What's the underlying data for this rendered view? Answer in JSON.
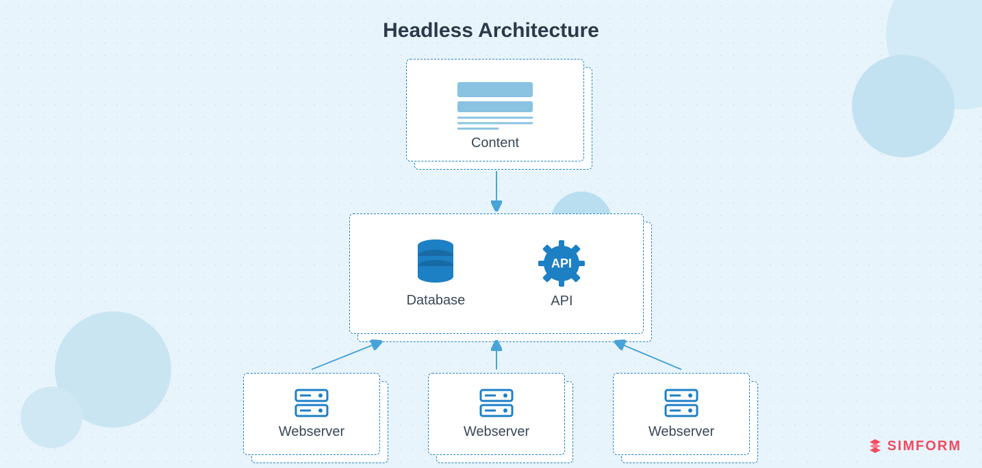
{
  "title": "Headless Architecture",
  "nodes": {
    "content": {
      "label": "Content",
      "icon": "content-layout-icon"
    },
    "database": {
      "label": "Database",
      "icon": "database-icon"
    },
    "api": {
      "label": "API",
      "icon": "api-gear-icon",
      "icon_text": "API"
    },
    "webservers": [
      {
        "label": "Webserver",
        "icon": "server-icon"
      },
      {
        "label": "Webserver",
        "icon": "server-icon"
      },
      {
        "label": "Webserver",
        "icon": "server-icon"
      }
    ]
  },
  "edges": [
    {
      "from": "content",
      "to": "database_api"
    },
    {
      "from": "webserver-1",
      "to": "database_api"
    },
    {
      "from": "webserver-2",
      "to": "database_api"
    },
    {
      "from": "webserver-3",
      "to": "database_api"
    }
  ],
  "colors": {
    "background": "#e8f4fb",
    "card_border": "#1d7fc4",
    "icon_fill": "#1d7fc4",
    "text": "#2b3a4a",
    "brand": "#f04a5f"
  },
  "brand": "SIMFORM"
}
